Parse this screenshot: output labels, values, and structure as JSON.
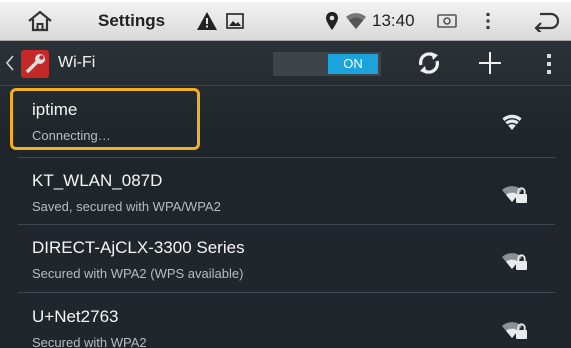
{
  "statusbar": {
    "title": "Settings",
    "time": "13:40"
  },
  "actionbar": {
    "title": "Wi-Fi",
    "toggle_label": "ON"
  },
  "networks": [
    {
      "ssid": "iptime",
      "status": "Connecting…",
      "secured": false,
      "highlighted": true
    },
    {
      "ssid": "KT_WLAN_087D",
      "status": "Saved, secured with WPA/WPA2",
      "secured": true
    },
    {
      "ssid": "DIRECT-AjCLX-3300 Series",
      "status": "Secured with WPA2 (WPS available)",
      "secured": true
    },
    {
      "ssid": "U+Net2763",
      "status": "Secured with WPA2",
      "secured": true
    }
  ],
  "colors": {
    "accent": "#1aa3dc",
    "highlight": "#f2b01e",
    "background": "#20272c"
  },
  "icons": [
    "home-icon",
    "warning-icon",
    "image-icon",
    "location-icon",
    "wifi-status-icon",
    "screenshot-icon",
    "overflow-menu-icon",
    "back-icon",
    "settings-app-icon",
    "refresh-icon",
    "add-icon",
    "wifi-signal-icon",
    "wifi-locked-icon"
  ]
}
